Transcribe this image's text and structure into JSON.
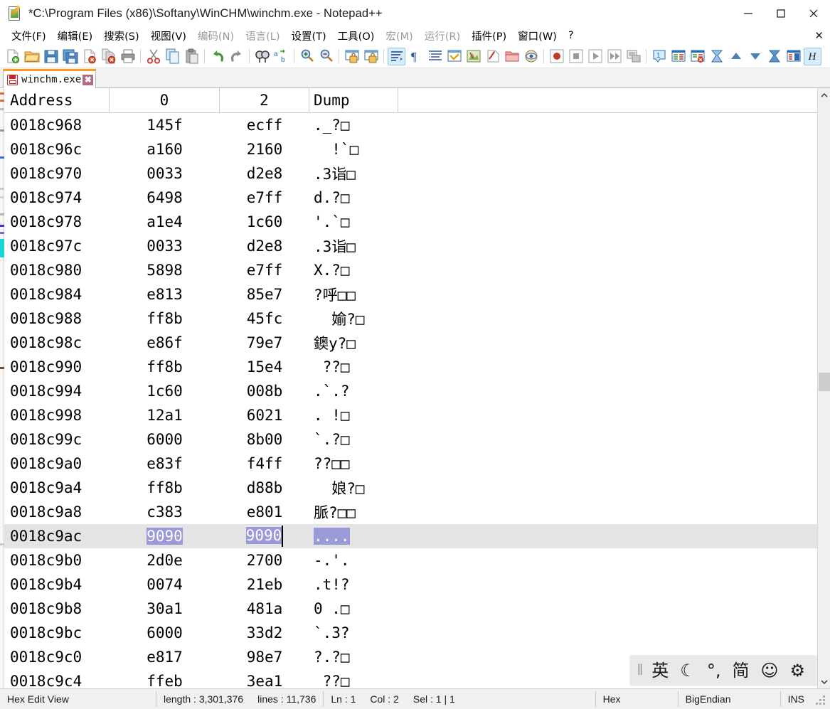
{
  "window": {
    "title": "*C:\\Program Files (x86)\\Softany\\WinCHM\\winchm.exe - Notepad++",
    "app_icon": "notepad-plus-plus-icon",
    "minimize_label": "—",
    "maximize_label": "☐",
    "close_label": "✕"
  },
  "menu": {
    "close_doc_label": "✕",
    "items": [
      {
        "text": "文件(F)",
        "accel": "F",
        "dim": false
      },
      {
        "text": "编辑(E)",
        "accel": "E",
        "dim": false
      },
      {
        "text": "搜索(S)",
        "accel": "S",
        "dim": false
      },
      {
        "text": "视图(V)",
        "accel": "V",
        "dim": false
      },
      {
        "text": "编码(N)",
        "accel": "N",
        "dim": true
      },
      {
        "text": "语言(L)",
        "accel": "L",
        "dim": true
      },
      {
        "text": "设置(T)",
        "accel": "T",
        "dim": false
      },
      {
        "text": "工具(O)",
        "accel": "O",
        "dim": false
      },
      {
        "text": "宏(M)",
        "accel": "M",
        "dim": true
      },
      {
        "text": "运行(R)",
        "accel": "R",
        "dim": true
      },
      {
        "text": "插件(P)",
        "accel": "P",
        "dim": false
      },
      {
        "text": "窗口(W)",
        "accel": "W",
        "dim": false
      },
      {
        "text": "?",
        "accel": "",
        "dim": false
      }
    ]
  },
  "toolbar": {
    "buttons": [
      {
        "name": "new-file-icon",
        "group": 0,
        "active": false
      },
      {
        "name": "open-file-icon",
        "group": 0,
        "active": false
      },
      {
        "name": "save-icon",
        "group": 0,
        "active": false
      },
      {
        "name": "save-all-icon",
        "group": 0,
        "active": false
      },
      {
        "name": "close-file-icon",
        "group": 0,
        "active": false
      },
      {
        "name": "close-all-files-icon",
        "group": 0,
        "active": false
      },
      {
        "name": "print-icon",
        "group": 0,
        "active": false
      },
      {
        "name": "cut-icon",
        "group": 1,
        "active": false
      },
      {
        "name": "copy-icon",
        "group": 1,
        "active": false
      },
      {
        "name": "paste-icon",
        "group": 1,
        "active": false
      },
      {
        "name": "undo-icon",
        "group": 2,
        "active": false
      },
      {
        "name": "redo-icon",
        "group": 2,
        "active": false
      },
      {
        "name": "find-icon",
        "group": 3,
        "active": false
      },
      {
        "name": "replace-icon",
        "group": 3,
        "active": false
      },
      {
        "name": "zoom-in-icon",
        "group": 4,
        "active": false
      },
      {
        "name": "zoom-out-icon",
        "group": 4,
        "active": false
      },
      {
        "name": "sync-vertical-icon",
        "group": 5,
        "active": false
      },
      {
        "name": "sync-horizontal-icon",
        "group": 5,
        "active": false
      },
      {
        "name": "word-wrap-icon",
        "group": 6,
        "active": true
      },
      {
        "name": "show-all-chars-icon",
        "group": 6,
        "active": false
      },
      {
        "name": "indent-guide-icon",
        "group": 6,
        "active": false
      },
      {
        "name": "user-defined-lang-icon",
        "group": 6,
        "active": false
      },
      {
        "name": "doc-map-icon",
        "group": 6,
        "active": false
      },
      {
        "name": "function-list-icon",
        "group": 6,
        "active": false
      },
      {
        "name": "folder-workspace-icon",
        "group": 6,
        "active": false
      },
      {
        "name": "monitor-icon",
        "group": 6,
        "active": false
      },
      {
        "name": "record-macro-icon",
        "group": 7,
        "active": false
      },
      {
        "name": "stop-macro-icon",
        "group": 7,
        "active": false
      },
      {
        "name": "play-macro-icon",
        "group": 7,
        "active": false
      },
      {
        "name": "run-macro-multiple-icon",
        "group": 7,
        "active": false
      },
      {
        "name": "save-macro-icon",
        "group": 7,
        "active": false
      },
      {
        "name": "bookmark-icon",
        "group": 8,
        "active": false
      },
      {
        "name": "compare-icon",
        "group": 8,
        "active": false
      },
      {
        "name": "compare-clear-icon",
        "group": 8,
        "active": false
      },
      {
        "name": "collapse-all-icon",
        "group": 8,
        "active": false
      },
      {
        "name": "fold-up-icon",
        "group": 8,
        "active": false
      },
      {
        "name": "unfold-down-icon",
        "group": 8,
        "active": false
      },
      {
        "name": "expand-all-icon",
        "group": 8,
        "active": false
      },
      {
        "name": "split-view-icon",
        "group": 8,
        "active": false
      },
      {
        "name": "hex-editor-icon",
        "group": 9,
        "active": true
      }
    ]
  },
  "tab": {
    "label": "winchm.exe",
    "icon": "unsaved-floppy-icon",
    "close_label": "✖",
    "modified": true
  },
  "hex_view": {
    "columns": [
      "Address",
      "0",
      "2",
      "Dump"
    ],
    "rows": [
      {
        "address": "0018c968",
        "h0": "145f",
        "h2": "ecff",
        "dump": "._?□"
      },
      {
        "address": "0018c96c",
        "h0": "a160",
        "h2": "2160",
        "dump": "  !`□"
      },
      {
        "address": "0018c970",
        "h0": "0033",
        "h2": "d2e8",
        "dump": ".3诣□"
      },
      {
        "address": "0018c974",
        "h0": "6498",
        "h2": "e7ff",
        "dump": "d.?□"
      },
      {
        "address": "0018c978",
        "h0": "a1e4",
        "h2": "1c60",
        "dump": "'.`□"
      },
      {
        "address": "0018c97c",
        "h0": "0033",
        "h2": "d2e8",
        "dump": ".3诣□"
      },
      {
        "address": "0018c980",
        "h0": "5898",
        "h2": "e7ff",
        "dump": "X.?□"
      },
      {
        "address": "0018c984",
        "h0": "e813",
        "h2": "85e7",
        "dump": "?呼□□"
      },
      {
        "address": "0018c988",
        "h0": "ff8b",
        "h2": "45fc",
        "dump": "  媮?□"
      },
      {
        "address": "0018c98c",
        "h0": "e86f",
        "h2": "79e7",
        "dump": "鐭y?□"
      },
      {
        "address": "0018c990",
        "h0": "ff8b",
        "h2": "15e4",
        "dump": " ??□"
      },
      {
        "address": "0018c994",
        "h0": "1c60",
        "h2": "008b",
        "dump": ".`.?"
      },
      {
        "address": "0018c998",
        "h0": "12a1",
        "h2": "6021",
        "dump": ". !□"
      },
      {
        "address": "0018c99c",
        "h0": "6000",
        "h2": "8b00",
        "dump": "`.?□"
      },
      {
        "address": "0018c9a0",
        "h0": "e83f",
        "h2": "f4ff",
        "dump": "??□□"
      },
      {
        "address": "0018c9a4",
        "h0": "ff8b",
        "h2": "d88b",
        "dump": "  娘?□"
      },
      {
        "address": "0018c9a8",
        "h0": "c383",
        "h2": "e801",
        "dump": "脈?□□"
      },
      {
        "address": "0018c9ac",
        "h0": "9090",
        "h2": "9090",
        "dump": "....",
        "current": true,
        "selected": true
      },
      {
        "address": "0018c9b0",
        "h0": "2d0e",
        "h2": "2700",
        "dump": "-.'."
      },
      {
        "address": "0018c9b4",
        "h0": "0074",
        "h2": "21eb",
        "dump": ".t!?"
      },
      {
        "address": "0018c9b8",
        "h0": "30a1",
        "h2": "481a",
        "dump": "0 .□"
      },
      {
        "address": "0018c9bc",
        "h0": "6000",
        "h2": "33d2",
        "dump": "`.3?"
      },
      {
        "address": "0018c9c0",
        "h0": "e817",
        "h2": "98e7",
        "dump": "?.?□"
      },
      {
        "address": "0018c9c4",
        "h0": "ffeb",
        "h2": "3ea1",
        "dump": " ??□"
      }
    ]
  },
  "ime": {
    "grip": "‖",
    "items": [
      {
        "name": "ime-language-mode",
        "glyph": "英"
      },
      {
        "name": "ime-shape-mode",
        "glyph": "☾"
      },
      {
        "name": "ime-punctuation-mode",
        "glyph": "°,"
      },
      {
        "name": "ime-simplified-mode",
        "glyph": "简"
      },
      {
        "name": "ime-emoji",
        "glyph": "☺"
      },
      {
        "name": "ime-settings",
        "glyph": "⚙"
      }
    ]
  },
  "statusbar": {
    "view_mode": "Hex Edit View",
    "length": "length : 3,301,376",
    "lines": "lines : 11,736",
    "ln": "Ln : 1",
    "col": "Col : 2",
    "sel": "Sel : 1 | 1",
    "format": "Hex",
    "endian": "BigEndian",
    "insert_mode": "INS"
  },
  "colors": {
    "selection": "#9a9ada",
    "current_line": "#e4e4e4",
    "tab_active_top": "#ff9d21",
    "toolbar_active": "#d9ecfb"
  }
}
